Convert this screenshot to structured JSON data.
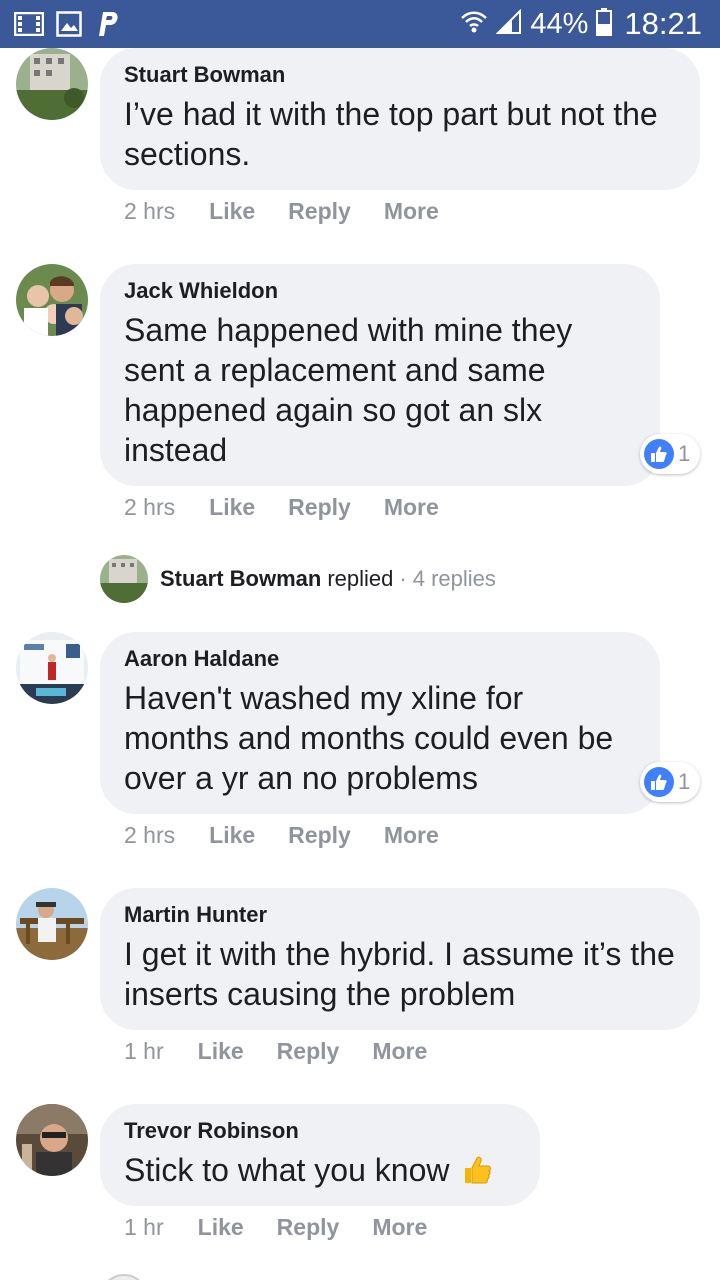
{
  "status_bar": {
    "left_icons": [
      "film-icon",
      "image-icon",
      "paypal-icon"
    ],
    "battery": "44%",
    "time": "18:21"
  },
  "comments": [
    {
      "author": "Stuart Bowman",
      "text": "I’ve had it with the top part but not the sections.",
      "time": "2 hrs",
      "like_label": "Like",
      "reply_label": "Reply",
      "more_label": "More"
    },
    {
      "author": "Jack Whieldon",
      "text": "Same happened with mine they sent a replacement and same happened again so got an slx instead",
      "reaction_count": "1",
      "time": "2 hrs",
      "like_label": "Like",
      "reply_label": "Reply",
      "more_label": "More"
    },
    {
      "author": "Aaron Haldane",
      "text": "Haven't washed my xline for months and months could even be over a yr an no problems",
      "reaction_count": "1",
      "time": "2 hrs",
      "like_label": "Like",
      "reply_label": "Reply",
      "more_label": "More"
    },
    {
      "author": "Martin Hunter",
      "text": "I get it with the hybrid. I assume it’s the inserts causing the problem",
      "time": "1 hr",
      "like_label": "Like",
      "reply_label": "Reply",
      "more_label": "More"
    },
    {
      "author": "Trevor Robinson",
      "text": "Stick to what you know",
      "time": "1 hr",
      "like_label": "Like",
      "reply_label": "Reply",
      "more_label": "More"
    }
  ],
  "reply_summary": {
    "name": "Stuart Bowman",
    "word": "replied",
    "dot": "·",
    "count": "4 replies"
  },
  "colors": {
    "header": "#3b5998",
    "bubble": "#f0f1f4",
    "like_blue": "#4080ff",
    "muted": "#90949c"
  }
}
